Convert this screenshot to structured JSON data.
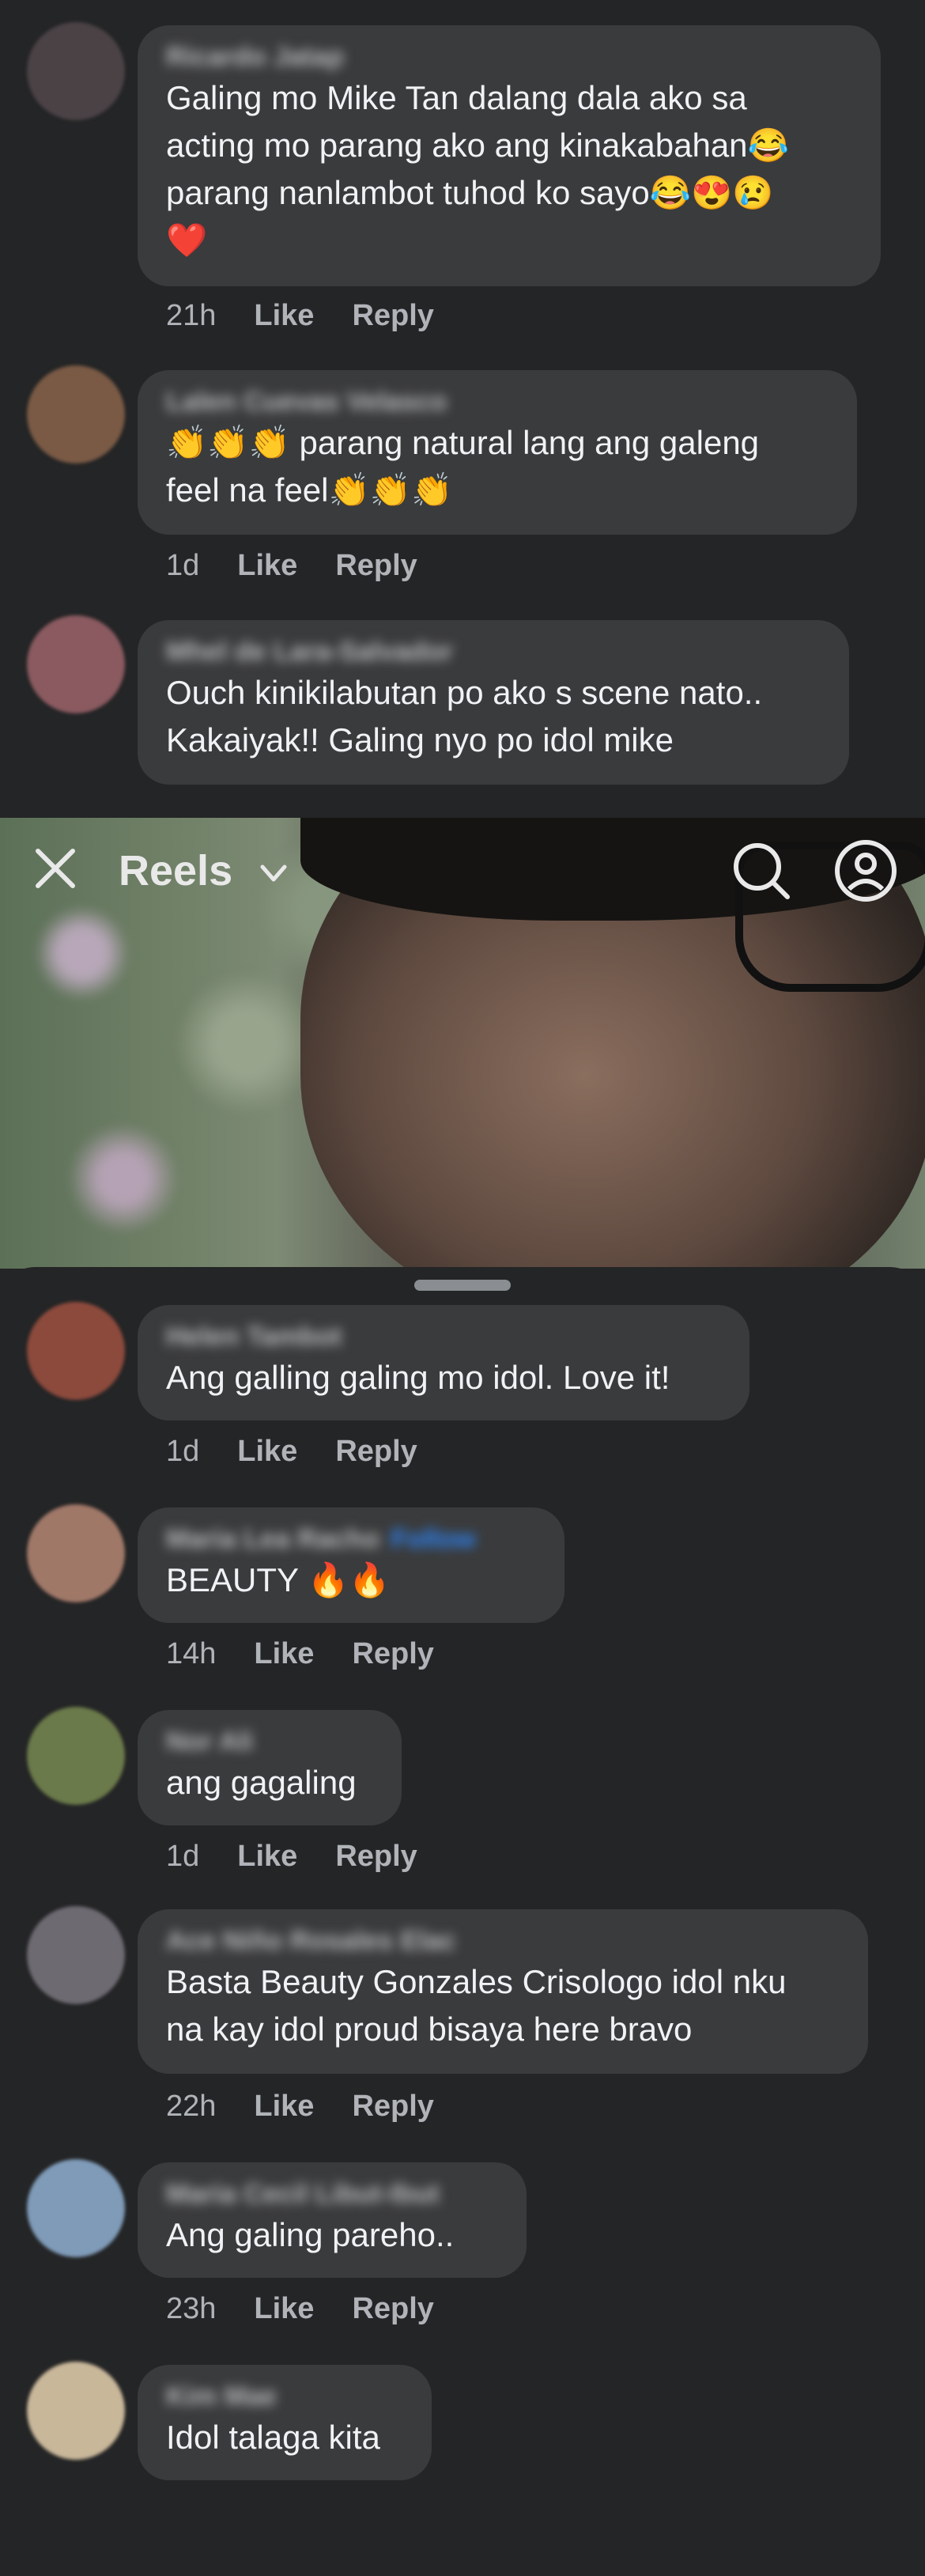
{
  "top_comments": [
    {
      "name": "Ricardo Jatap",
      "text": "Galing mo Mike Tan dalang dala ako sa\nacting mo parang ako ang kinakabahan😂\nparang nanlambot tuhod ko sayo😂😍😢\n❤️",
      "time": "21h",
      "like": "Like",
      "reply": "Reply",
      "avatar_color": "#4b4246"
    },
    {
      "name": "Lalen Cuevas Velasco",
      "text": "👏👏👏 parang natural lang ang galeng\nfeel na feel👏👏👏",
      "time": "1d",
      "like": "Like",
      "reply": "Reply",
      "avatar_color": "#7a5a45"
    },
    {
      "name": "Mhel de Lara-Salvador",
      "text": "Ouch kinikilabutan po ako s scene nato..\nKakaiyak!! Galing nyo po idol mike",
      "avatar_color": "#8a5a60"
    }
  ],
  "reels": {
    "title": "Reels",
    "icons": [
      "close-icon",
      "chevron-down-icon",
      "search-icon",
      "profile-icon"
    ]
  },
  "sheet_comments": [
    {
      "name": "Helen Tambot",
      "text": "Ang galling galing mo idol. Love it!",
      "time": "1d",
      "like": "Like",
      "reply": "Reply",
      "avatar_color": "#8c4a3c"
    },
    {
      "name": "Maria Lea Racho",
      "follow": "Follow",
      "text": "BEAUTY 🔥🔥",
      "time": "14h",
      "like": "Like",
      "reply": "Reply",
      "avatar_color": "#a07868"
    },
    {
      "name": "Nor Ali",
      "text": "ang gagaling",
      "time": "1d",
      "like": "Like",
      "reply": "Reply",
      "avatar_color": "#6b7a4a"
    },
    {
      "name": "Ace Niño Rosales Elac",
      "text": "Basta Beauty Gonzales Crisologo idol nku\nna kay idol proud bisaya here bravo",
      "time": "22h",
      "like": "Like",
      "reply": "Reply",
      "avatar_color": "#6e6a72"
    },
    {
      "name": "Maria Cecil Libut-Ibut",
      "text": "Ang galing pareho..",
      "time": "23h",
      "like": "Like",
      "reply": "Reply",
      "avatar_color": "#7f9bb8"
    },
    {
      "name": "Kim Mae",
      "text": "Idol talaga kita",
      "avatar_color": "#c9b79a"
    }
  ]
}
